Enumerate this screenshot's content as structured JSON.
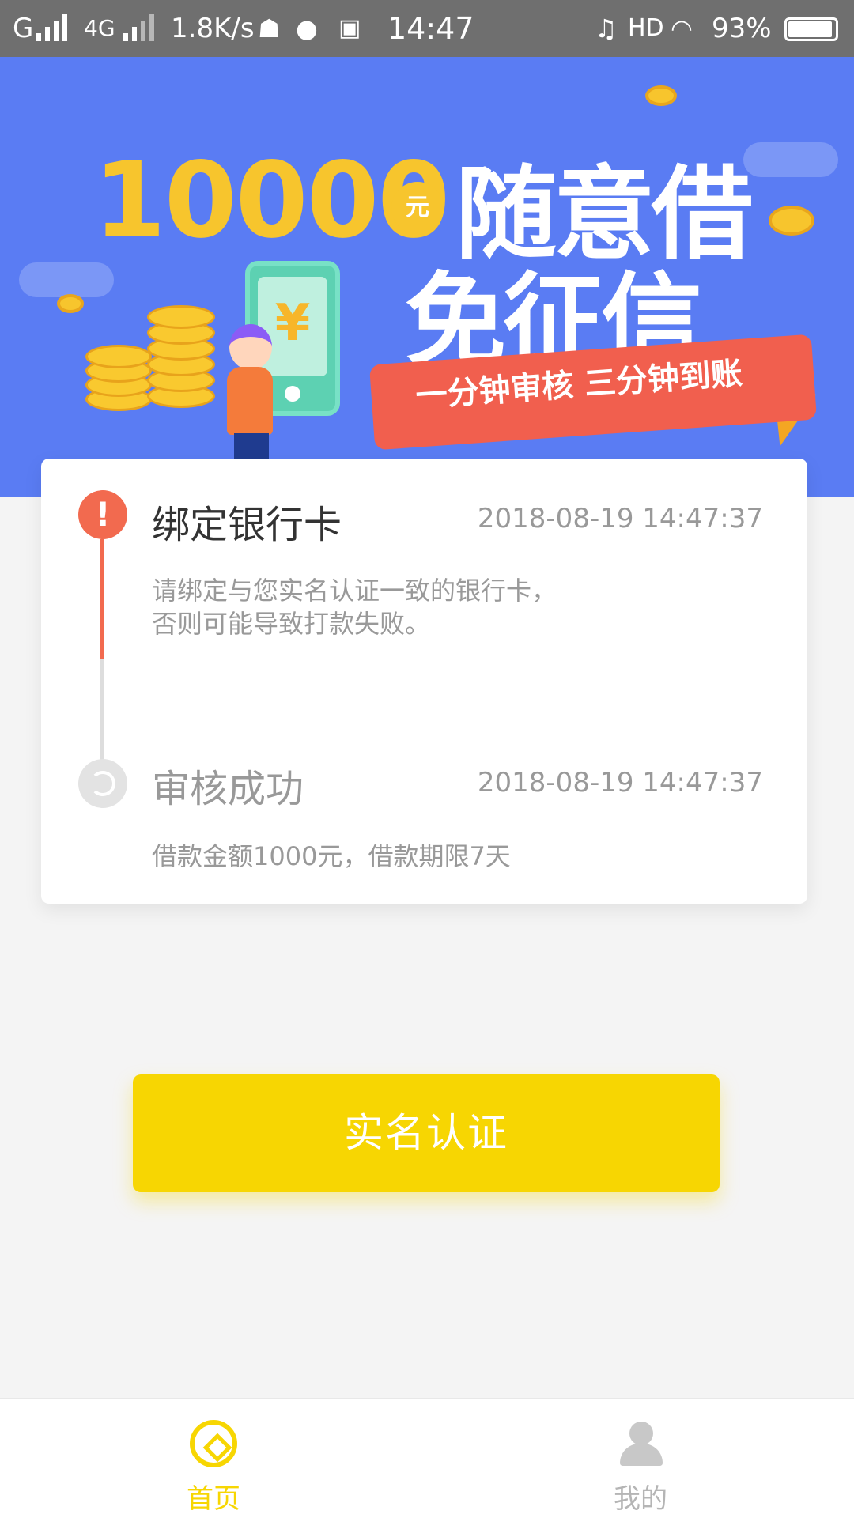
{
  "status_bar": {
    "carrier": "G",
    "network": "4G",
    "speed": "1.8K/s",
    "time": "14:47",
    "hd": "HD",
    "battery": "93%",
    "icons": [
      "signal-icon",
      "android-icon",
      "chat-icon",
      "s-icon",
      "mute-icon",
      "wifi-icon",
      "battery-icon"
    ]
  },
  "banner": {
    "amount": "10000",
    "amount_unit": "元",
    "headline_1": "随意借",
    "headline_2": "免征信",
    "slogan": "一分钟审核 三分钟到账",
    "phone_symbol": "¥"
  },
  "steps": [
    {
      "title": "绑定银行卡",
      "time": "2018-08-19 14:47:37",
      "desc": "请绑定与您实名认证一致的银行卡，否则可能导致打款失败。",
      "status": "alert",
      "icon": "alert-icon"
    },
    {
      "title": "审核成功",
      "time": "2018-08-19 14:47:37",
      "desc": "借款金额1000元，借款期限7天",
      "status": "pending",
      "icon": "refresh-icon"
    }
  ],
  "cta_label": "实名认证",
  "nav": [
    {
      "label": "首页",
      "icon": "home-icon",
      "active": true
    },
    {
      "label": "我的",
      "icon": "user-icon",
      "active": false
    }
  ],
  "colors": {
    "accent": "#f7d602",
    "alert": "#f26a4f",
    "banner_bg": "#5a7cf3",
    "coin": "#f7c52d"
  }
}
